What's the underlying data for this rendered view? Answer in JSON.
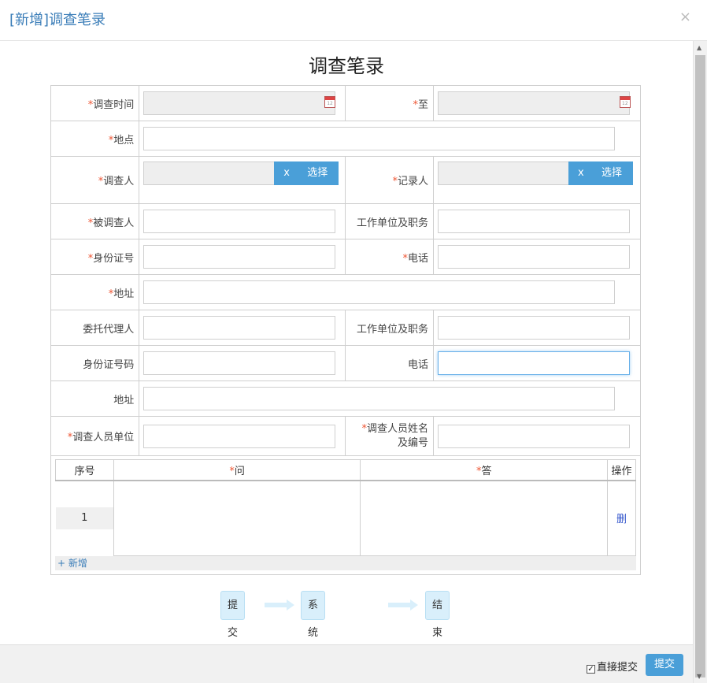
{
  "modal": {
    "title": "[新增]调查笔录",
    "close": "×"
  },
  "doc_title": "调查笔录",
  "required_mark": "*",
  "fields": {
    "time": "调查时间",
    "to": "至",
    "place": "地点",
    "investigator": "调查人",
    "recorder": "记录人",
    "respondent": "被调查人",
    "work_unit": "工作单位及职务",
    "id_card": "身份证号",
    "phone": "电话",
    "address": "地址",
    "agent": "委托代理人",
    "agent_work_unit": "工作单位及职务",
    "agent_id": "身份证号码",
    "agent_phone": "电话",
    "agent_address": "地址",
    "investigator_unit": "调查人员单位",
    "investigator_name_1": "调查人员姓名",
    "investigator_name_2": "及编号"
  },
  "calendar_icon_text": "12",
  "picker": {
    "clear": "x",
    "select": "选择"
  },
  "qa_table": {
    "headers": {
      "seq": "序号",
      "question": "问",
      "answer": "答",
      "action": "操作"
    },
    "rows": [
      {
        "seq": "1",
        "delete": "删"
      }
    ],
    "add": "+ 新增"
  },
  "flow": {
    "step1": "提交",
    "step2": "系统自动通过",
    "step3": "结束"
  },
  "footer": {
    "direct_submit": "直接提交",
    "submit": "提交",
    "checked": true
  },
  "colors": {
    "accent": "#4a9fd8",
    "title": "#3a7db8",
    "required": "#e53"
  }
}
